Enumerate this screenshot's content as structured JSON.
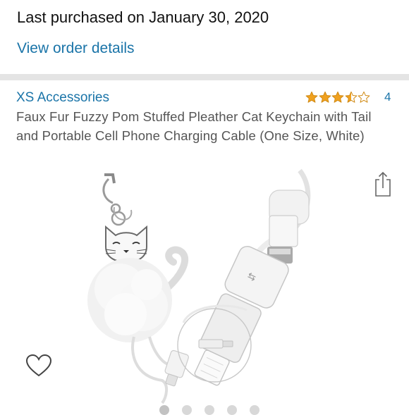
{
  "order": {
    "purchased_text": "Last purchased on January 30, 2020",
    "view_order_label": "View order details"
  },
  "product": {
    "brand": "XS Accessories",
    "rating": 3.5,
    "rating_max": 5,
    "review_count": "4",
    "title": "Faux Fur Fuzzy Pom Stuffed Pleather Cat Keychain with Tail and Portable Cell Phone Charging Cable (One Size, White)"
  },
  "icons": {
    "share": "share-icon",
    "favorite": "heart-icon",
    "star": "star-icon"
  },
  "colors": {
    "link": "#1a74a8",
    "star": "#f0a11f",
    "text_primary": "#111111",
    "text_secondary": "#555555",
    "divider": "#e4e4e4"
  },
  "carousel": {
    "page_count": 5,
    "current_page": 1
  }
}
